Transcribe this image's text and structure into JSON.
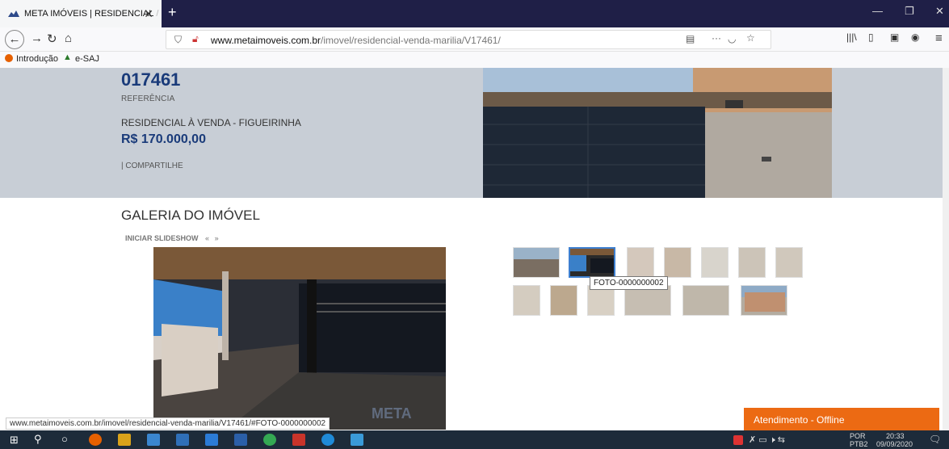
{
  "browser": {
    "tab_title": "META IMÓVEIS | RESIDENCIAL",
    "tab_close": "✕",
    "new_tab": "+",
    "url_domain": "www.metaimoveis.com.br",
    "url_path": "/imovel/residencial-venda-marilia/V17461/",
    "bookmarks": [
      "Introdução",
      "e-SAJ"
    ],
    "status_url": "www.metaimoveis.com.br/imovel/residencial-venda-marilia/V17461/#FOTO-0000000002"
  },
  "property": {
    "ref_number": "017461",
    "ref_label": "REFERÊNCIA",
    "title": "RESIDENCIAL À VENDA - FIGUEIRINHA",
    "price": "R$ 170.000,00",
    "share": "| COMPARTILHE"
  },
  "gallery": {
    "heading": "GALERIA DO IMÓVEL",
    "slideshow": "INICIAR SLIDESHOW",
    "prev": "«",
    "next": "»",
    "tooltip": "FOTO-0000000002",
    "watermark": "META"
  },
  "chat": {
    "label": "Atendimento - Offline"
  },
  "taskbar": {
    "lang": "POR",
    "layout": "PTB2",
    "time": "20:33",
    "date": "09/09/2020"
  }
}
